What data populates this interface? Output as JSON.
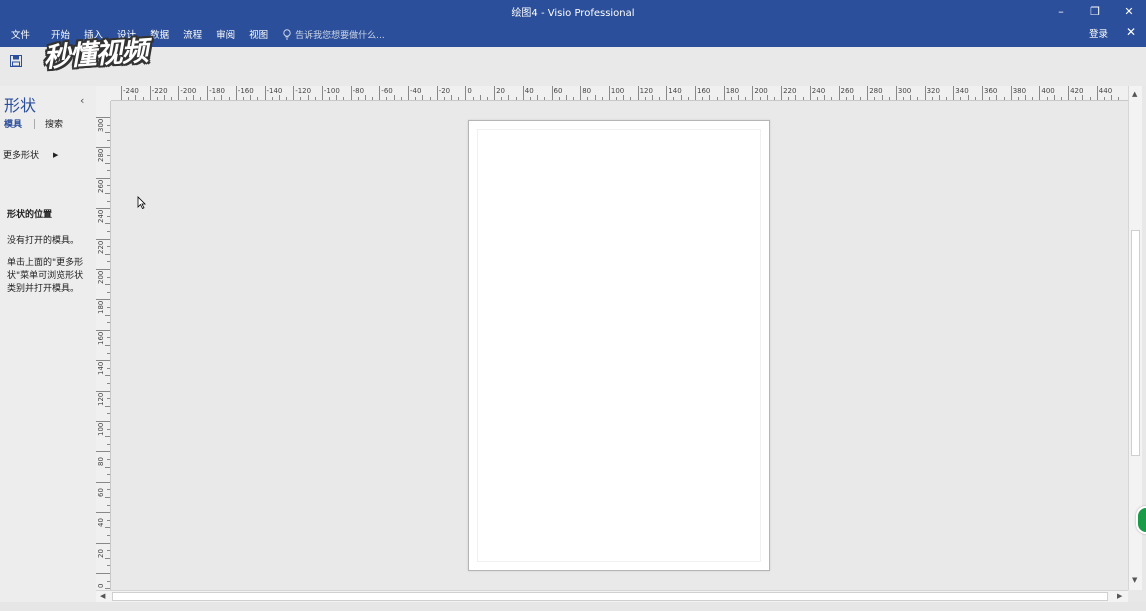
{
  "window": {
    "title": "绘图4 - Visio Professional",
    "minimize_glyph": "–",
    "restore_glyph": "❐",
    "close_glyph": "✕"
  },
  "menu": {
    "items": [
      "文件",
      "开始",
      "插入",
      "设计",
      "数据",
      "流程",
      "审阅",
      "视图"
    ],
    "tell_me_placeholder": "告诉我您想要做什么...",
    "login": "登录",
    "close_doc_glyph": "✕"
  },
  "watermark": "秒懂视频",
  "panel": {
    "title": "形状",
    "collapse_glyph": "‹",
    "tab_stencil": "模具",
    "tab_search": "搜索",
    "more_shapes": "更多形状",
    "more_arrow": "▶",
    "location_heading": "形状的位置",
    "no_stencil": "没有打开的模具。",
    "instruction": "单击上面的\"更多形状\"菜单可浏览形状类别并打开模具。"
  },
  "ruler": {
    "horizontal_labels": [
      "-240",
      "-220",
      "-200",
      "-180",
      "-160",
      "-140",
      "-120",
      "-100",
      "-80",
      "-60",
      "-40",
      "-20",
      "0",
      "20",
      "40",
      "60",
      "80",
      "100",
      "120",
      "140",
      "160",
      "180",
      "200",
      "220",
      "240",
      "260",
      "280",
      "300",
      "320",
      "340",
      "360",
      "380",
      "400",
      "420",
      "440"
    ],
    "vertical_labels": [
      "300",
      "280",
      "260",
      "240",
      "220",
      "200",
      "180",
      "160",
      "140",
      "120",
      "100",
      "80",
      "60",
      "40",
      "20",
      "0"
    ]
  },
  "scroll": {
    "up": "▲",
    "down": "▼",
    "left": "◀",
    "right": "▶"
  },
  "colors": {
    "titlebar": "#2b4f9a",
    "accent": "#2b4f9a",
    "green_button": "#1b9b47"
  }
}
